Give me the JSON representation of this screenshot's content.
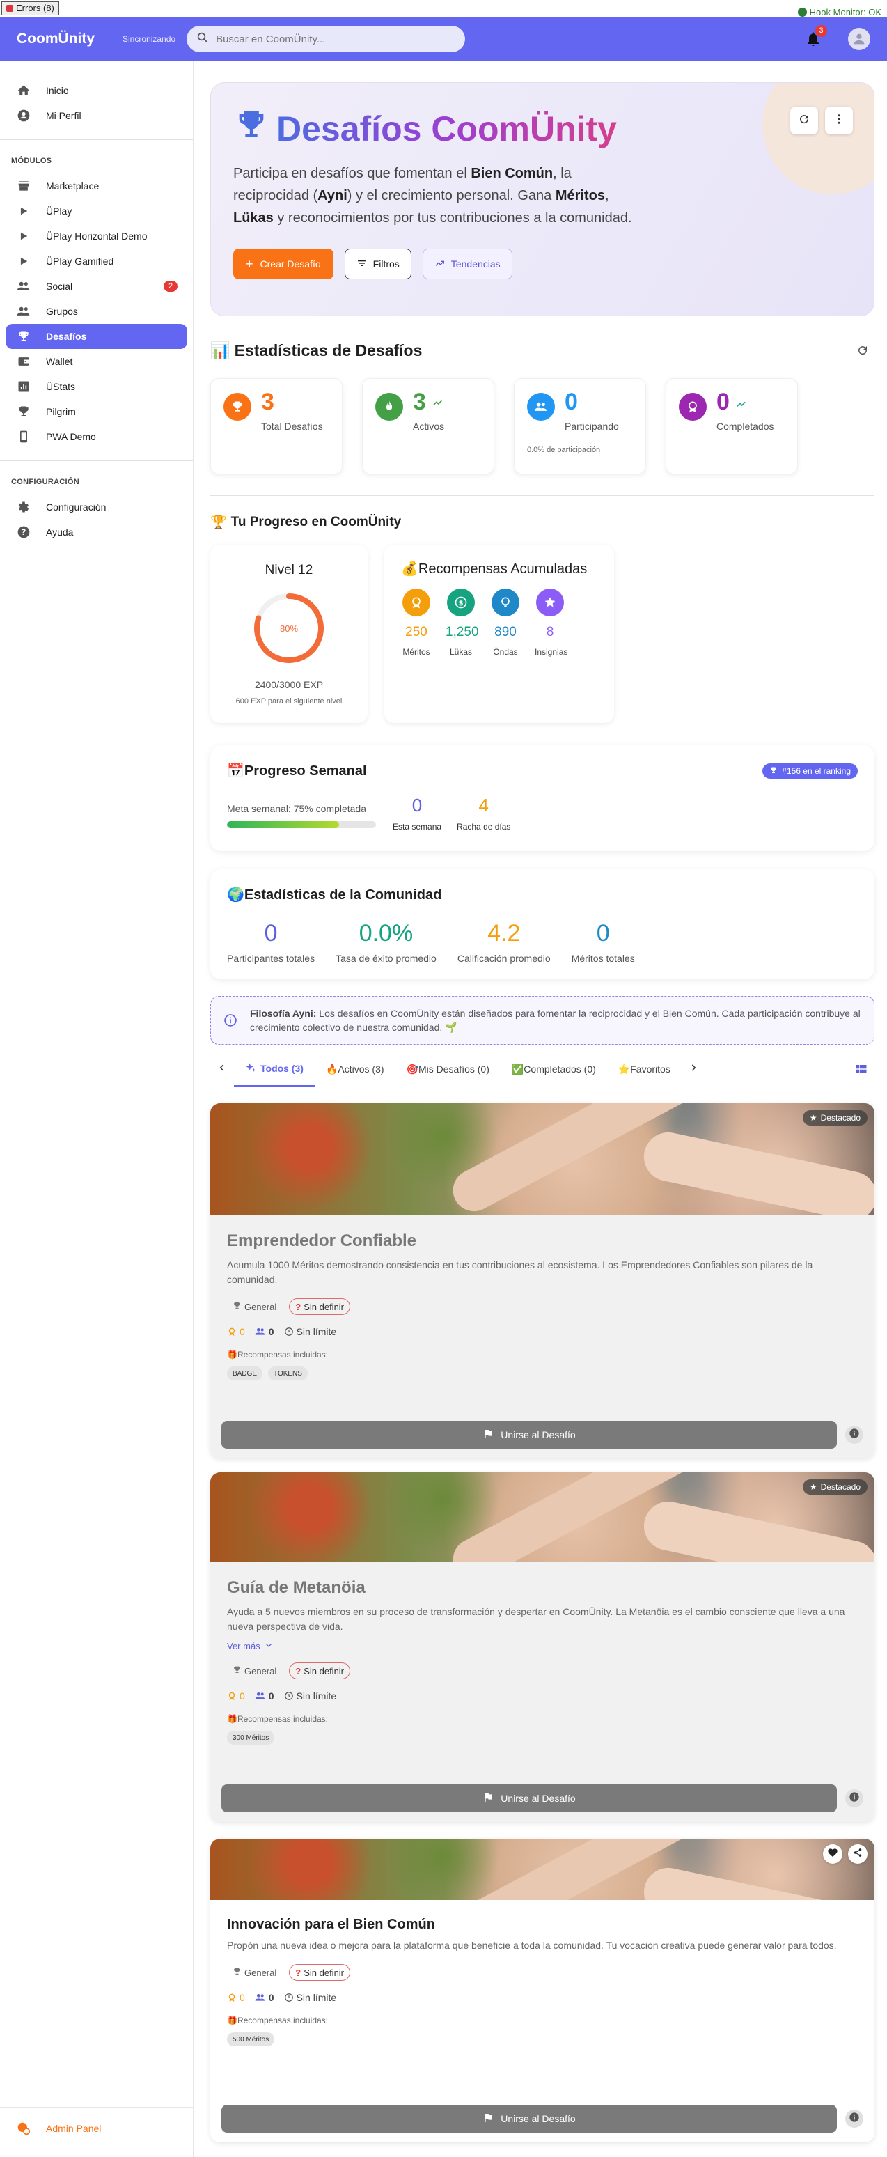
{
  "error_badge": "Errors (8)",
  "hook_monitor": "Hook Monitor: OK",
  "header": {
    "brand": "CoomÜnity",
    "sync": "Sincronizando",
    "search_placeholder": "Buscar en CoomÜnity...",
    "notif_count": "3",
    "accent": "#6366f1"
  },
  "sidebar": {
    "top_items": [
      {
        "label": "Inicio",
        "icon": "home-icon"
      },
      {
        "label": "Mi Perfil",
        "icon": "account-icon"
      }
    ],
    "modules_label": "MÓDULOS",
    "module_items": [
      {
        "label": "Marketplace",
        "icon": "store-icon"
      },
      {
        "label": "ÜPlay",
        "icon": "play-icon"
      },
      {
        "label": "ÜPlay Horizontal Demo",
        "icon": "play-icon"
      },
      {
        "label": "ÜPlay Gamified",
        "icon": "play-icon"
      },
      {
        "label": "Social",
        "icon": "people-icon",
        "badge": "2"
      },
      {
        "label": "Grupos",
        "icon": "group-icon"
      },
      {
        "label": "Desafíos",
        "icon": "trophy-icon"
      },
      {
        "label": "Wallet",
        "icon": "wallet-icon"
      },
      {
        "label": "ÜStats",
        "icon": "stats-icon"
      },
      {
        "label": "Pilgrim",
        "icon": "trophy-icon"
      },
      {
        "label": "PWA Demo",
        "icon": "phone-icon"
      }
    ],
    "config_label": "CONFIGURACIÓN",
    "config_items": [
      {
        "label": "Configuración",
        "icon": "gear-icon"
      },
      {
        "label": "Ayuda",
        "icon": "help-icon"
      }
    ],
    "admin": "Admin Panel"
  },
  "hero": {
    "title": "Desafíos CoomÜnity",
    "desc_parts": [
      "Participa en desafíos que fomentan el ",
      "Bien Común",
      ", la reciprocidad (",
      "Ayni",
      ") y el crecimiento personal. Gana ",
      "Méritos",
      ", ",
      "Lükas",
      " y reconocimientos por tus contribuciones a la comunidad."
    ],
    "create_btn": "Crear Desafío",
    "filters_btn": "Filtros",
    "trends_btn": "Tendencias"
  },
  "stats": {
    "title": "Estadísticas de Desafíos",
    "cards": [
      {
        "value": "3",
        "label": "Total Desafíos",
        "color": "#f97316"
      },
      {
        "value": "3",
        "label": "Activos",
        "color": "#43a047"
      },
      {
        "value": "0",
        "label": "Participando",
        "color": "#2196f3",
        "sub": "0.0% de participación"
      },
      {
        "value": "0",
        "label": "Completados",
        "color": "#9c27b0"
      }
    ]
  },
  "progress": {
    "title": "Tu Progreso en CoomÜnity",
    "level": "Nivel 12",
    "percent": 80,
    "percent_label": "80%",
    "exp": "2400/3000 EXP",
    "next": "600 EXP para el siguiente nivel",
    "rewards_title": "Recompensas Acumuladas",
    "rewards": [
      {
        "value": "250",
        "label": "Méritos",
        "color": "#f59e0b"
      },
      {
        "value": "1,250",
        "label": "Lükas",
        "color": "#16a37f"
      },
      {
        "value": "890",
        "label": "Öndas",
        "color": "#1e88c8"
      },
      {
        "value": "8",
        "label": "Insignias",
        "color": "#8b5cf6"
      }
    ]
  },
  "weekly": {
    "title": "Progreso Semanal",
    "rank": "#156 en el ranking",
    "goal": "Meta semanal: 75% completada",
    "goal_percent": 75,
    "this_week": "0",
    "this_week_label": "Esta semana",
    "streak": "4",
    "streak_label": "Racha de días"
  },
  "community": {
    "title": "Estadísticas de la Comunidad",
    "items": [
      {
        "value": "0",
        "label": "Participantes totales",
        "color": "#5c5fe0"
      },
      {
        "value": "0.0%",
        "label": "Tasa de éxito promedio",
        "color": "#16a37f"
      },
      {
        "value": "4.2",
        "label": "Calificación promedio",
        "color": "#f59e0b"
      },
      {
        "value": "0",
        "label": "Méritos totales",
        "color": "#1e88c8"
      }
    ]
  },
  "philosophy": {
    "bold": "Filosofía Ayni:",
    "text": " Los desafíos en CoomÜnity están diseñados para fomentar la reciprocidad y el Bien Común. Cada participación contribuye al crecimiento colectivo de nuestra comunidad. 🌱"
  },
  "tabs": [
    "Todos (3)",
    "🔥Activos (3)",
    "🎯Mis Desafíos (0)",
    "✅Completados (0)",
    "⭐Favoritos"
  ],
  "challenges": [
    {
      "title": "Emprendedor Confiable",
      "desc": "Acumula 1000 Méritos demostrando consistencia en tus contribuciones al ecosistema. Los Emprendedores Confiables son pilares de la comunidad.",
      "category": "General",
      "difficulty": "Sin definir",
      "merits": "0",
      "participants": "0",
      "time": "Sin límite",
      "rewards_label": "🎁Recompensas incluidas:",
      "rewards": [
        "BADGE",
        "TOKENS"
      ],
      "featured": "Destacado",
      "join": "Unirse al Desafío"
    },
    {
      "title": "Guía de Metanöia",
      "desc": "Ayuda a 5 nuevos miembros en su proceso de transformación y despertar en CoomÜnity. La Metanöia es el cambio consciente que lleva a una nueva perspectiva de vida.",
      "more": "Ver más",
      "category": "General",
      "difficulty": "Sin definir",
      "merits": "0",
      "participants": "0",
      "time": "Sin límite",
      "rewards_label": "🎁Recompensas incluidas:",
      "rewards": [
        "300 Méritos"
      ],
      "featured": "Destacado",
      "join": "Unirse al Desafío"
    },
    {
      "title": "Innovación para el Bien Común",
      "desc": "Propón una nueva idea o mejora para la plataforma que beneficie a toda la comunidad. Tu vocación creativa puede generar valor para todos.",
      "category": "General",
      "difficulty": "Sin definir",
      "merits": "0",
      "participants": "0",
      "time": "Sin límite",
      "rewards_label": "🎁Recompensas incluidas:",
      "rewards": [
        "500 Méritos"
      ],
      "join": "Unirse al Desafío"
    }
  ]
}
